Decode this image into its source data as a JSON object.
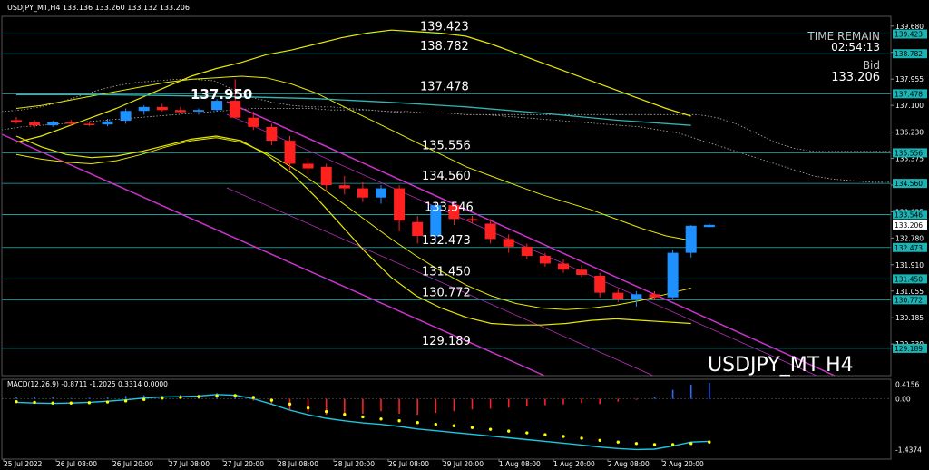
{
  "chart_data": {
    "type": "candlestick",
    "title": "USDJPY_MT,H4  133.136 133.260 133.132 133.206",
    "watermark": "USDJPY_MT H4",
    "info": {
      "time_remain_label": "TIME REMAIN",
      "time_remain": "02:54:13",
      "bid_label": "Bid",
      "bid": "133.206"
    },
    "peak_label": "137.950",
    "ylim": [
      128.3,
      140.0
    ],
    "y_ticks": [
      "139.680",
      "138.825",
      "137.955",
      "137.100",
      "136.230",
      "135.375",
      "134.505",
      "133.635",
      "132.780",
      "131.910",
      "131.055",
      "130.185",
      "129.330"
    ],
    "x_labels": [
      "25 Jul 2022",
      "26 Jul 08:00",
      "26 Jul 20:00",
      "27 Jul 08:00",
      "27 Jul 20:00",
      "28 Jul 08:00",
      "28 Jul 20:00",
      "29 Jul 08:00",
      "29 Jul 20:00",
      "1 Aug 08:00",
      "1 Aug 20:00",
      "2 Aug 08:00",
      "2 Aug 20:00"
    ],
    "levels": [
      {
        "value": 139.423,
        "label": "139.423"
      },
      {
        "value": 138.782,
        "label": "138.782"
      },
      {
        "value": 137.478,
        "label": "137.478"
      },
      {
        "value": 135.556,
        "label": "135.556"
      },
      {
        "value": 134.56,
        "label": "134.560"
      },
      {
        "value": 133.546,
        "label": "133.546"
      },
      {
        "value": 132.473,
        "label": "132.473"
      },
      {
        "value": 131.45,
        "label": "131.450"
      },
      {
        "value": 130.772,
        "label": "130.772"
      },
      {
        "value": 129.189,
        "label": "129.189"
      }
    ],
    "candles": [
      {
        "o": 136.62,
        "h": 136.72,
        "l": 136.5,
        "c": 136.55
      },
      {
        "o": 136.55,
        "h": 136.62,
        "l": 136.38,
        "c": 136.45
      },
      {
        "o": 136.45,
        "h": 136.6,
        "l": 136.4,
        "c": 136.55
      },
      {
        "o": 136.55,
        "h": 136.63,
        "l": 136.45,
        "c": 136.5
      },
      {
        "o": 136.5,
        "h": 136.58,
        "l": 136.42,
        "c": 136.48
      },
      {
        "o": 136.48,
        "h": 136.66,
        "l": 136.42,
        "c": 136.58
      },
      {
        "o": 136.6,
        "h": 137.0,
        "l": 136.5,
        "c": 136.92
      },
      {
        "o": 136.92,
        "h": 137.1,
        "l": 136.8,
        "c": 137.05
      },
      {
        "o": 137.05,
        "h": 137.15,
        "l": 136.9,
        "c": 136.95
      },
      {
        "o": 136.95,
        "h": 137.05,
        "l": 136.85,
        "c": 136.88
      },
      {
        "o": 136.9,
        "h": 137.0,
        "l": 136.8,
        "c": 136.95
      },
      {
        "o": 136.95,
        "h": 137.3,
        "l": 136.9,
        "c": 137.25
      },
      {
        "o": 137.25,
        "h": 137.95,
        "l": 137.1,
        "c": 136.7
      },
      {
        "o": 136.7,
        "h": 136.9,
        "l": 136.3,
        "c": 136.4
      },
      {
        "o": 136.4,
        "h": 136.5,
        "l": 135.8,
        "c": 135.95
      },
      {
        "o": 135.95,
        "h": 136.1,
        "l": 135.0,
        "c": 135.2
      },
      {
        "o": 135.2,
        "h": 135.4,
        "l": 134.85,
        "c": 135.05
      },
      {
        "o": 135.1,
        "h": 135.2,
        "l": 134.3,
        "c": 134.5
      },
      {
        "o": 134.5,
        "h": 134.8,
        "l": 134.2,
        "c": 134.4
      },
      {
        "o": 134.4,
        "h": 134.6,
        "l": 133.95,
        "c": 134.1
      },
      {
        "o": 134.1,
        "h": 134.5,
        "l": 133.9,
        "c": 134.4
      },
      {
        "o": 134.4,
        "h": 134.5,
        "l": 133.0,
        "c": 133.35
      },
      {
        "o": 133.3,
        "h": 133.5,
        "l": 132.6,
        "c": 132.85
      },
      {
        "o": 132.85,
        "h": 133.95,
        "l": 132.7,
        "c": 133.85
      },
      {
        "o": 133.85,
        "h": 133.9,
        "l": 133.2,
        "c": 133.4
      },
      {
        "o": 133.4,
        "h": 133.5,
        "l": 133.25,
        "c": 133.35
      },
      {
        "o": 133.25,
        "h": 133.4,
        "l": 132.6,
        "c": 132.75
      },
      {
        "o": 132.75,
        "h": 132.9,
        "l": 132.3,
        "c": 132.5
      },
      {
        "o": 132.5,
        "h": 132.6,
        "l": 132.1,
        "c": 132.2
      },
      {
        "o": 132.2,
        "h": 132.3,
        "l": 131.85,
        "c": 131.95
      },
      {
        "o": 131.95,
        "h": 132.1,
        "l": 131.65,
        "c": 131.75
      },
      {
        "o": 131.75,
        "h": 131.9,
        "l": 131.5,
        "c": 131.58
      },
      {
        "o": 131.55,
        "h": 131.65,
        "l": 130.85,
        "c": 131.0
      },
      {
        "o": 131.0,
        "h": 131.1,
        "l": 130.7,
        "c": 130.8
      },
      {
        "o": 130.8,
        "h": 131.05,
        "l": 130.55,
        "c": 130.95
      },
      {
        "o": 130.95,
        "h": 131.05,
        "l": 130.75,
        "c": 130.85
      },
      {
        "o": 130.85,
        "h": 132.4,
        "l": 130.8,
        "c": 132.3
      },
      {
        "o": 132.3,
        "h": 133.2,
        "l": 132.15,
        "c": 133.18
      },
      {
        "o": 133.14,
        "h": 133.26,
        "l": 133.13,
        "c": 133.21
      }
    ],
    "macd": {
      "label": "MACD(12,26,9) -0.8711 -1.2025 0.3314 0.0000",
      "y_ticks": [
        "0.4156",
        "0.00",
        "-1.4374"
      ],
      "ylim": [
        -1.7,
        0.55
      ],
      "hist": [
        0.04,
        0.06,
        0.05,
        0.02,
        0.03,
        0.04,
        0.08,
        0.1,
        0.09,
        0.11,
        0.12,
        0.16,
        0.08,
        -0.05,
        -0.15,
        -0.3,
        -0.38,
        -0.45,
        -0.4,
        -0.42,
        -0.35,
        -0.42,
        -0.45,
        -0.4,
        -0.35,
        -0.3,
        -0.28,
        -0.25,
        -0.22,
        -0.18,
        -0.16,
        -0.12,
        -0.15,
        -0.08,
        -0.03,
        0.05,
        0.25,
        0.4,
        0.45
      ],
      "main": [
        -0.1,
        -0.12,
        -0.13,
        -0.12,
        -0.1,
        -0.07,
        -0.03,
        0.02,
        0.05,
        0.06,
        0.08,
        0.12,
        0.1,
        0.0,
        -0.15,
        -0.32,
        -0.45,
        -0.55,
        -0.62,
        -0.68,
        -0.72,
        -0.78,
        -0.85,
        -0.9,
        -0.95,
        -1.0,
        -1.05,
        -1.1,
        -1.15,
        -1.2,
        -1.25,
        -1.3,
        -1.36,
        -1.4,
        -1.43,
        -1.42,
        -1.33,
        -1.22,
        -1.2
      ],
      "signal": [
        -0.08,
        -0.1,
        -0.12,
        -0.12,
        -0.11,
        -0.09,
        -0.06,
        -0.02,
        0.02,
        0.04,
        0.06,
        0.08,
        0.09,
        0.04,
        -0.04,
        -0.15,
        -0.26,
        -0.36,
        -0.44,
        -0.51,
        -0.57,
        -0.62,
        -0.67,
        -0.72,
        -0.76,
        -0.81,
        -0.86,
        -0.91,
        -0.96,
        -1.01,
        -1.06,
        -1.11,
        -1.17,
        -1.22,
        -1.26,
        -1.29,
        -1.29,
        -1.26,
        -1.22
      ]
    }
  },
  "colors": {
    "background": "#000000",
    "up_candle": "#1e90ff",
    "down_candle": "#ff2020",
    "level_line": "#1bb3b3",
    "channel": "#cc33cc",
    "bollinger": "#e8e800",
    "cloud": "#b0b0b0",
    "ma_line": "#32b4b4",
    "text": "#ffffff",
    "macd_hist_up": "#2a6cff",
    "macd_hist_down": "#ff2020",
    "macd_main": "#1bc8e0",
    "macd_signal": "#ffff00"
  }
}
